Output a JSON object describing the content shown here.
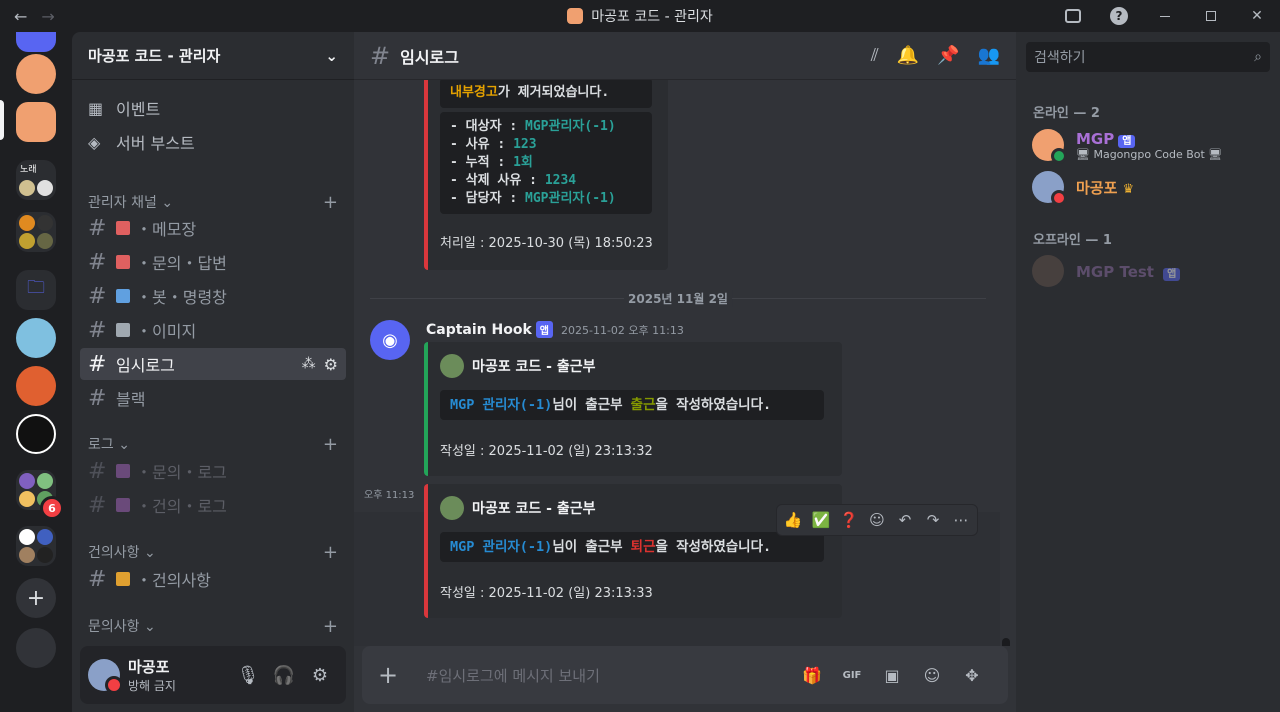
{
  "window": {
    "title": "마공포 코드 - 관리자",
    "back_icon": "←",
    "forward_icon": "→",
    "help_icon": "?",
    "close_icon": "✕"
  },
  "servers": {
    "home_icon_label": "",
    "folder_label": "🗀",
    "add_label": "+",
    "badge_count": "6",
    "mini_label": "노래"
  },
  "guild": {
    "name": "마공포 코드 - 관리자",
    "chevron": "⌄",
    "events_label": "이벤트",
    "boost_label": "서버 부스트",
    "categories": [
      {
        "name": "관리자 채널",
        "arrow": "⌄",
        "plus": "+"
      },
      {
        "name": "로그",
        "arrow": "⌄",
        "plus": "+"
      },
      {
        "name": "건의사항",
        "arrow": "⌄",
        "plus": "+"
      },
      {
        "name": "문의사항",
        "arrow": "⌄",
        "plus": "+"
      }
    ],
    "channels": [
      {
        "name": "・메모장"
      },
      {
        "name": "・문의・답변"
      },
      {
        "name": "・봇・명령창"
      },
      {
        "name": "・이미지"
      },
      {
        "name": "임시로그"
      },
      {
        "name": "블랙"
      },
      {
        "name": "・문의・로그"
      },
      {
        "name": "・건의・로그"
      },
      {
        "name": "・건의사항"
      }
    ],
    "hash": "#"
  },
  "user": {
    "name": "마공포",
    "status": "방해 금지"
  },
  "channel": {
    "name": "임시로그",
    "composer_placeholder": "#임시로그에 메시지 보내기",
    "gif_label": "GIF"
  },
  "messages": {
    "embed1": {
      "warn_word": "내부경고",
      "warn_rest": "가 제거되었습니다.",
      "lines": [
        {
          "k": "- 대상자  : ",
          "v": "MGP관리자(-1)"
        },
        {
          "k": "- 사유  : ",
          "v": "123"
        },
        {
          "k": "- 누적  : ",
          "v": "1회"
        },
        {
          "k": "- 삭제 사유  : ",
          "v": "1234"
        },
        {
          "k": "- 담당자  : ",
          "v": "MGP관리자(-1)"
        }
      ],
      "footer": "처리일 : 2025-10-30 (목) 18:50:23"
    },
    "date_divider": "2025년 11월 2일",
    "author": "Captain Hook",
    "app_tag": "앱",
    "timestamp": "2025-11-02 오후 11:13",
    "embed2": {
      "author": "마공포 코드 - 출근부",
      "mgp": "MGP",
      "admin": "관리자(-1)",
      "mid": "님이 출근부 ",
      "action": "출근",
      "tail": "을 작성하였습니다.",
      "footer": "작성일 : 2025-11-02 (일) 23:13:32"
    },
    "short_time": "오후 11:13",
    "embed3": {
      "author": "마공포 코드 - 출근부",
      "mgp": "MGP",
      "admin": "관리자(-1)",
      "mid": "님이 출근부 ",
      "action": "퇴근",
      "tail": "을 작성하였습니다.",
      "footer": "작성일 : 2025-11-02 (일) 23:13:33"
    },
    "reactions": [
      "👍",
      "✅",
      "❓",
      "☺",
      "↶",
      "↷",
      "⋯"
    ]
  },
  "members": {
    "search_placeholder": "검색하기",
    "online_header": "온라인 — 2",
    "offline_header": "오프라인 — 1",
    "list": [
      {
        "name": "MGP",
        "tag": "앱",
        "sub": "🖥 Magongpo Code Bot 🖥",
        "color": "#a970d6"
      },
      {
        "name": "마공포",
        "crown": "♛",
        "color": "#f0a050"
      },
      {
        "name": "MGP Test",
        "tag": "앱",
        "color": "#5c4d6b"
      }
    ]
  },
  "colors": {
    "accent": "#5865f2",
    "embed_red": "#da373c",
    "embed_green": "#23a559"
  }
}
